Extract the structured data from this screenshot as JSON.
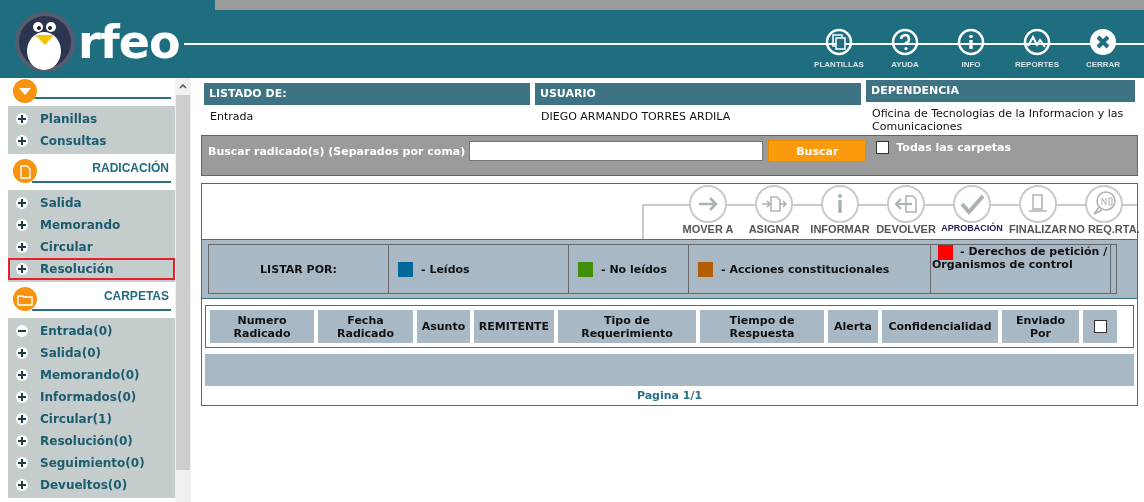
{
  "header": {
    "logo": "rfeo",
    "tools": [
      {
        "label": "PLANTILLAS",
        "kind": "templates"
      },
      {
        "label": "AYUDA",
        "kind": "help"
      },
      {
        "label": "INFO",
        "kind": "info"
      },
      {
        "label": "REPORTES",
        "kind": "reports"
      },
      {
        "label": "CERRAR",
        "kind": "close"
      }
    ]
  },
  "sidebar": {
    "sections": [
      {
        "kind": "toggle",
        "items": [
          {
            "label": "Planillas",
            "expanded": false,
            "selected": false
          },
          {
            "label": "Consultas",
            "expanded": false,
            "selected": false
          }
        ]
      },
      {
        "title": "RADICACIÓN",
        "kind": "document",
        "items": [
          {
            "label": "Salida",
            "expanded": false,
            "selected": false
          },
          {
            "label": "Memorando",
            "expanded": false,
            "selected": false
          },
          {
            "label": "Circular",
            "expanded": false,
            "selected": false
          },
          {
            "label": "Resolución",
            "expanded": false,
            "selected": true
          }
        ]
      },
      {
        "title": "CARPETAS",
        "kind": "folder",
        "items": [
          {
            "label": "Entrada(0)",
            "expanded": true,
            "selected": false
          },
          {
            "label": "Salida(0)",
            "expanded": false,
            "selected": false
          },
          {
            "label": "Memorando(0)",
            "expanded": false,
            "selected": false
          },
          {
            "label": "Informados(0)",
            "expanded": false,
            "selected": false
          },
          {
            "label": "Circular(1)",
            "expanded": false,
            "selected": false
          },
          {
            "label": "Resolución(0)",
            "expanded": false,
            "selected": false
          },
          {
            "label": "Seguimiento(0)",
            "expanded": false,
            "selected": false
          },
          {
            "label": "Devueltos(0)",
            "expanded": false,
            "selected": false
          }
        ]
      }
    ]
  },
  "info": [
    {
      "label": "LISTADO DE:",
      "value": "Entrada"
    },
    {
      "label": "USUARIO",
      "value": "DIEGO ARMANDO TORRES ARDILA"
    },
    {
      "label": "DEPENDENCIA",
      "value": "Oficina de Tecnologias de la Informacion y las Comunicaciones"
    }
  ],
  "search": {
    "label": "Buscar radicado(s) (Separados por coma)",
    "button": "Buscar",
    "all_folders": {
      "label": "Todas las carpetas",
      "checked": false
    }
  },
  "actions": [
    {
      "label": "MOVER A",
      "kind": "move"
    },
    {
      "label": "ASIGNAR",
      "kind": "assign"
    },
    {
      "label": "INFORMAR",
      "kind": "inform"
    },
    {
      "label": "DEVOLVER",
      "kind": "return"
    },
    {
      "label": "APROBACIÓN",
      "kind": "approve"
    },
    {
      "label": "FINALIZAR",
      "kind": "finish"
    },
    {
      "label": "NO REQ.RTA.",
      "kind": "noreply"
    }
  ],
  "legend": {
    "title": "LISTAR POR:",
    "items": [
      {
        "label": "- Leídos",
        "color": "#00679c"
      },
      {
        "label": "- No leídos",
        "color": "#3f8f0b"
      },
      {
        "label": "- Acciones constitucionales",
        "color": "#b55d04"
      },
      {
        "label": "- Derechos de petición / Organismos de control",
        "color": "#ff0000"
      }
    ]
  },
  "table": {
    "columns": [
      "Numero Radicado",
      "Fecha Radicado",
      "Asunto",
      "REMITENTE",
      "Tipo de Requerimiento",
      "Tiempo de Respuesta",
      "Alerta",
      "Confidencialidad",
      "Enviado Por"
    ],
    "select_all": {
      "checked": false
    }
  },
  "pager": "Pagina 1/1"
}
